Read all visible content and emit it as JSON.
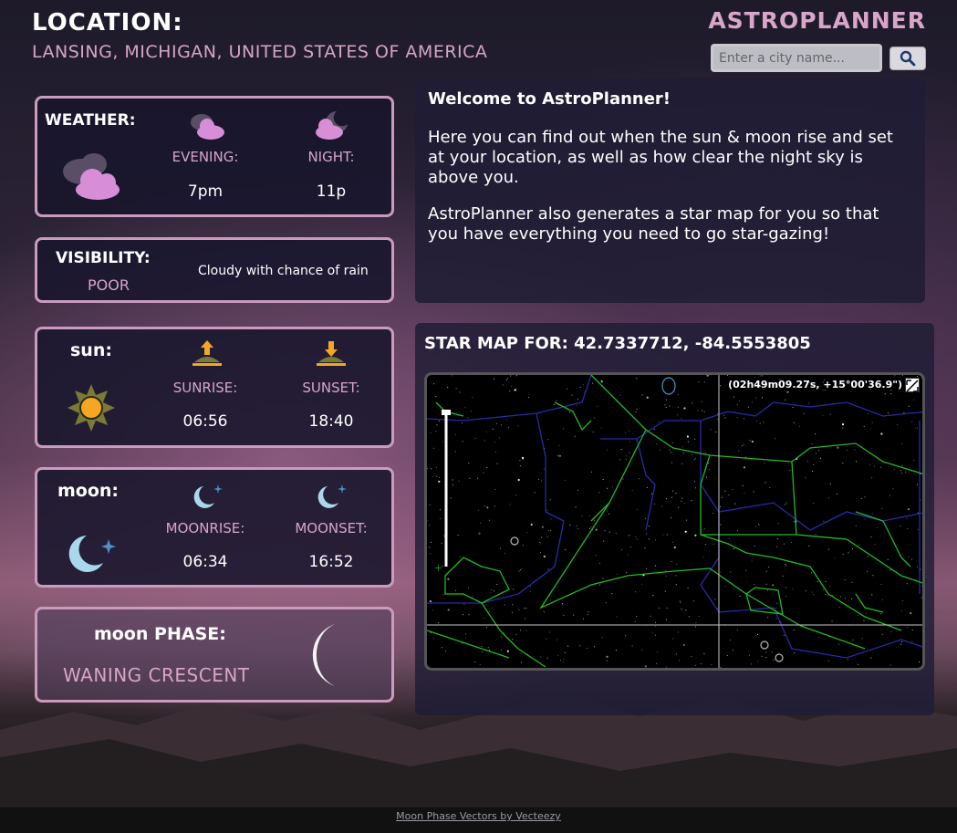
{
  "header": {
    "location_label": "LOCATION:",
    "location_value": "LANSING, MICHIGAN, UNITED STATES OF AMERICA",
    "brand": "ASTROPLANNER"
  },
  "search": {
    "placeholder": "Enter a city name..."
  },
  "weather": {
    "title": "WEATHER:",
    "evening_label": "EVENING:",
    "evening_value": "7pm",
    "night_label": "NIGHT:",
    "night_value": "11p"
  },
  "visibility": {
    "title": "VISIBILITY:",
    "rating": "POOR",
    "description": "Cloudy with chance of rain"
  },
  "sun": {
    "title": "sun:",
    "sunrise_label": "SUNRISE:",
    "sunrise_value": "06:56",
    "sunset_label": "SUNSET:",
    "sunset_value": "18:40"
  },
  "moon": {
    "title": "moon:",
    "moonrise_label": "MOONRISE:",
    "moonrise_value": "06:34",
    "moonset_label": "MOONSET:",
    "moonset_value": "16:52"
  },
  "moon_phase": {
    "title": "moon PHASE:",
    "value": "WANING CRESCENT"
  },
  "info": {
    "heading": "Welcome to AstroPlanner!",
    "para1": "Here you can find out when the sun & moon rise and set at your location, as well as how clear the night sky is above you.",
    "para2": "AstroPlanner also generates a star map for you so that you have everything you need to go star-gazing!"
  },
  "starmap": {
    "title": "STAR MAP FOR: 42.7337712, -84.5553805",
    "coordinates": "(02h49m09.27s, +15°00'36.9\")"
  },
  "footer": {
    "credit": "Moon Phase Vectors by Vecteezy"
  },
  "colors": {
    "accent": "#d6a5c8",
    "card_border": "#c99bbd",
    "sun": "#f5a623",
    "moon": "#a9d8ec"
  }
}
